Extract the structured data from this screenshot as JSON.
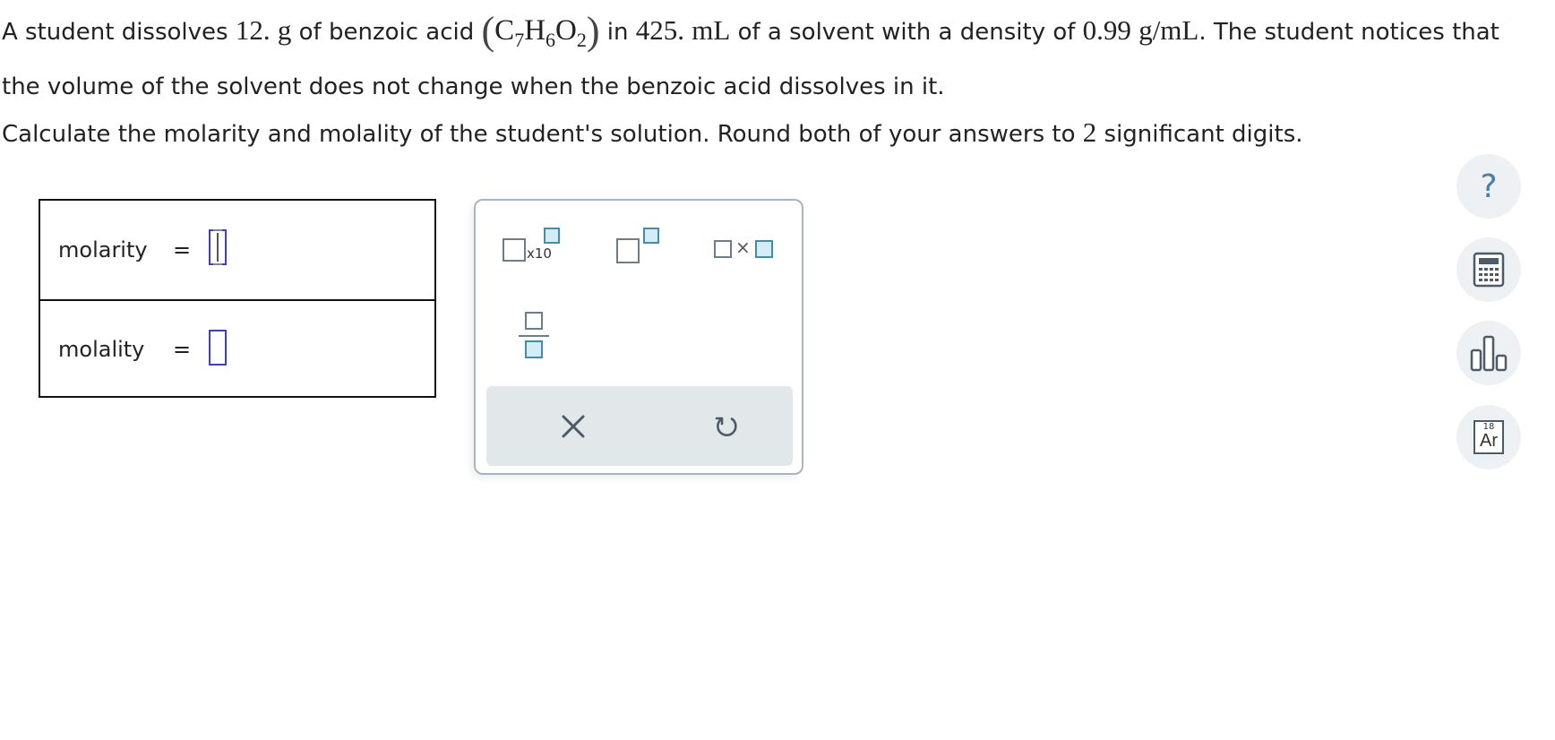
{
  "question": {
    "p1_a": "A student dissolves",
    "mass": "12.",
    "mass_unit": "g",
    "p1_b": "of benzoic acid",
    "paren_open": "(",
    "paren_close": ")",
    "chem_c": "C",
    "chem_c_sub": "7",
    "chem_h": "H",
    "chem_h_sub": "6",
    "chem_o": "O",
    "chem_o_sub": "2",
    "p1_c": "in",
    "volume": "425.",
    "volume_unit": "mL",
    "p1_d": "of a solvent with a density of",
    "density": "0.99",
    "density_unit": "g/mL",
    "p1_e": ". The student notices that the volume of the solvent does not change when the benzoic acid dissolves in it.",
    "p2_a": "Calculate the molarity and molality of the student's solution. Round both of your answers to",
    "sig": "2",
    "p2_b": "significant digits."
  },
  "answers": {
    "molarity_label": "molarity",
    "molality_label": "molality",
    "equals": "=",
    "molarity_value": "",
    "molality_value": ""
  },
  "palette": {
    "x10_label": "x10",
    "times_symbol": "×"
  },
  "sidebar": {
    "help_glyph": "?",
    "periodic_number": "18",
    "periodic_symbol": "Ar"
  },
  "colors": {
    "input_border": "#3b3bd6",
    "palette_border": "#a7b4c2",
    "control_bar": "#e2e7ea",
    "icon_dark": "#4d5b66",
    "help_blue": "#4a7fa8"
  }
}
